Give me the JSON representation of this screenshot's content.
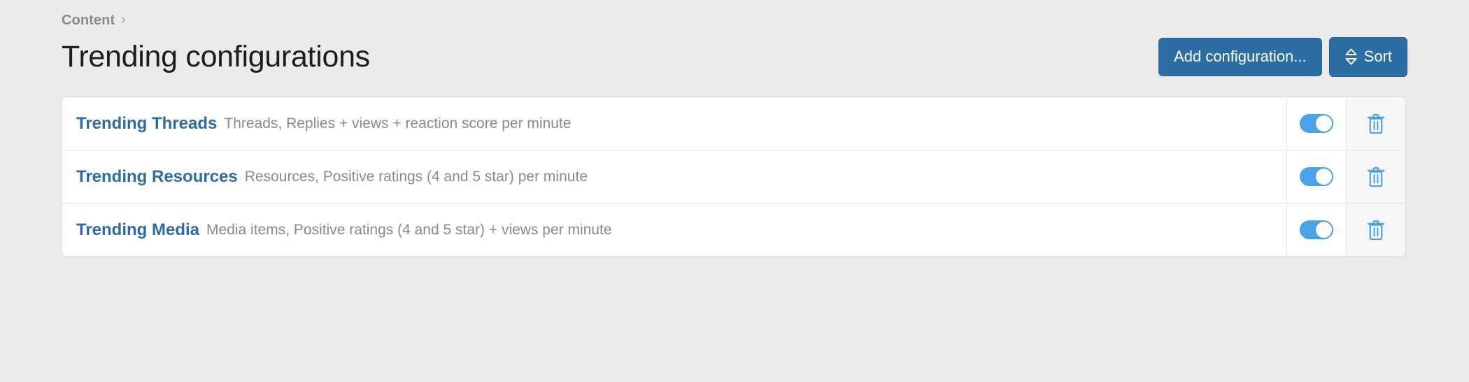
{
  "breadcrumb": {
    "items": [
      "Content"
    ],
    "separator": "›",
    "separator_icon": "chevron-right-icon"
  },
  "header": {
    "title": "Trending configurations",
    "actions": [
      {
        "label": "Add configuration...",
        "icon": null,
        "name": "add-configuration-button"
      },
      {
        "label": "Sort",
        "icon": "sort-updown-icon",
        "name": "sort-button"
      }
    ]
  },
  "colors": {
    "page_background": "#ebebeb",
    "button_blue": "#2c6da4",
    "link_blue": "#2d6ca8",
    "toggle_on_blue": "#4aa3e8",
    "trash_blue": "#4aa3e8",
    "muted_text": "#8a8a8a",
    "card_background": "#ffffff",
    "delete_cell_background": "#f7f7f7"
  },
  "list": {
    "rows": [
      {
        "title": "Trending Threads",
        "description": "Threads, Replies + views + reaction score per minute",
        "enabled": true,
        "toggle_state": "on",
        "delete_icon": "trash-icon"
      },
      {
        "title": "Trending Resources",
        "description": "Resources, Positive ratings (4 and 5 star) per minute",
        "enabled": true,
        "toggle_state": "on",
        "delete_icon": "trash-icon"
      },
      {
        "title": "Trending Media",
        "description": "Media items, Positive ratings (4 and 5 star) + views per minute",
        "enabled": true,
        "toggle_state": "on",
        "delete_icon": "trash-icon"
      }
    ]
  }
}
